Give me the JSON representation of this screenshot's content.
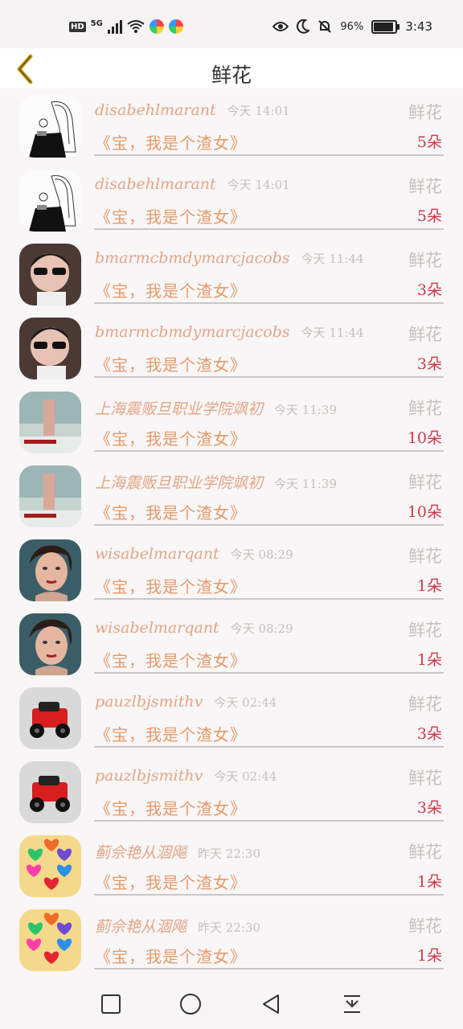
{
  "status_bar": {
    "hd": "HD",
    "network": "5G",
    "battery": "96%",
    "time": "3:43"
  },
  "header": {
    "title": "鲜花",
    "back_icon": "chevron-left-icon"
  },
  "list": [
    {
      "name": "disabehlmarant",
      "time": "今天 14:01",
      "tag": "鲜花",
      "message": "《宝，我是个渣女》",
      "count": "5朵",
      "avatar": "sketch-girl"
    },
    {
      "name": "disabehlmarant",
      "time": "今天 14:01",
      "tag": "鲜花",
      "message": "《宝，我是个渣女》",
      "count": "5朵",
      "avatar": "sketch-girl"
    },
    {
      "name": "bmarmcbmdymarcjacobs",
      "time": "今天 11:44",
      "tag": "鲜花",
      "message": "《宝，我是个渣女》",
      "count": "3朵",
      "avatar": "sunglasses-kid"
    },
    {
      "name": "bmarmcbmdymarcjacobs",
      "time": "今天 11:44",
      "tag": "鲜花",
      "message": "《宝，我是个渣女》",
      "count": "3朵",
      "avatar": "sunglasses-kid"
    },
    {
      "name": "上海震贩旦职业学院飒初",
      "time": "今天 11:39",
      "tag": "鲜花",
      "message": "《宝，我是个渣女》",
      "count": "10朵",
      "avatar": "photo-scene"
    },
    {
      "name": "上海震贩旦职业学院飒初",
      "time": "今天 11:39",
      "tag": "鲜花",
      "message": "《宝，我是个渣女》",
      "count": "10朵",
      "avatar": "photo-scene"
    },
    {
      "name": "wisabelmarqant",
      "time": "今天 08:29",
      "tag": "鲜花",
      "message": "《宝，我是个渣女》",
      "count": "1朵",
      "avatar": "woman-portrait"
    },
    {
      "name": "wisabelmarqant",
      "time": "今天 08:29",
      "tag": "鲜花",
      "message": "《宝，我是个渣女》",
      "count": "1朵",
      "avatar": "woman-portrait"
    },
    {
      "name": "pauzlbjsmithv",
      "time": "今天 02:44",
      "tag": "鲜花",
      "message": "《宝，我是个渣女》",
      "count": "3朵",
      "avatar": "red-car"
    },
    {
      "name": "pauzlbjsmithv",
      "time": "今天 02:44",
      "tag": "鲜花",
      "message": "《宝，我是个渣女》",
      "count": "3朵",
      "avatar": "red-car"
    },
    {
      "name": "蓟佘艳从涸飚",
      "time": "昨天 22:30",
      "tag": "鲜花",
      "message": "《宝，我是个渣女》",
      "count": "1朵",
      "avatar": "hearts"
    },
    {
      "name": "蓟佘艳从涸飚",
      "time": "昨天 22:30",
      "tag": "鲜花",
      "message": "《宝，我是个渣女》",
      "count": "1朵",
      "avatar": "hearts"
    }
  ],
  "nav": [
    "square-icon",
    "circle-icon",
    "triangle-back-icon",
    "download-arrow-icon"
  ],
  "colors": {
    "name": "#e3a586",
    "message": "#e59a6a",
    "count": "#d0384a",
    "muted": "#c7c1bd"
  }
}
